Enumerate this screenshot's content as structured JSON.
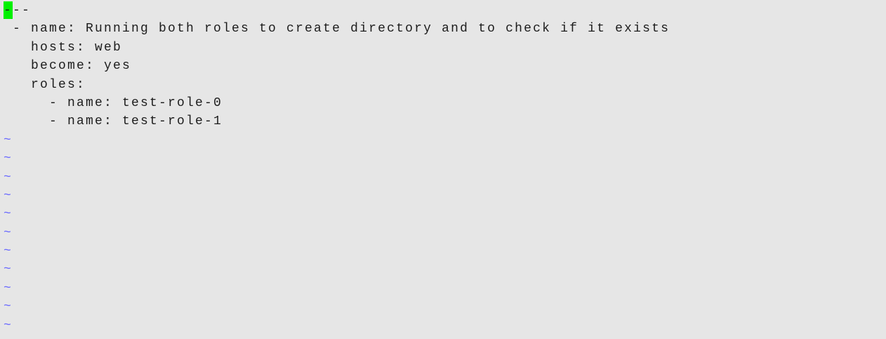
{
  "editor": {
    "cursor_char": "-",
    "first_line_rest": "--",
    "lines": [
      " - name: Running both roles to create directory and to check if it exists",
      "   hosts: web",
      "   become: yes",
      "   roles:",
      "     - name: test-role-0",
      "     - name: test-role-1"
    ],
    "tilde": "~",
    "tilde_count": 11,
    "colors": {
      "background": "#e6e6e6",
      "cursor": "#00f000",
      "tilde": "#6a6aff",
      "text": "#1c1c1c"
    }
  }
}
